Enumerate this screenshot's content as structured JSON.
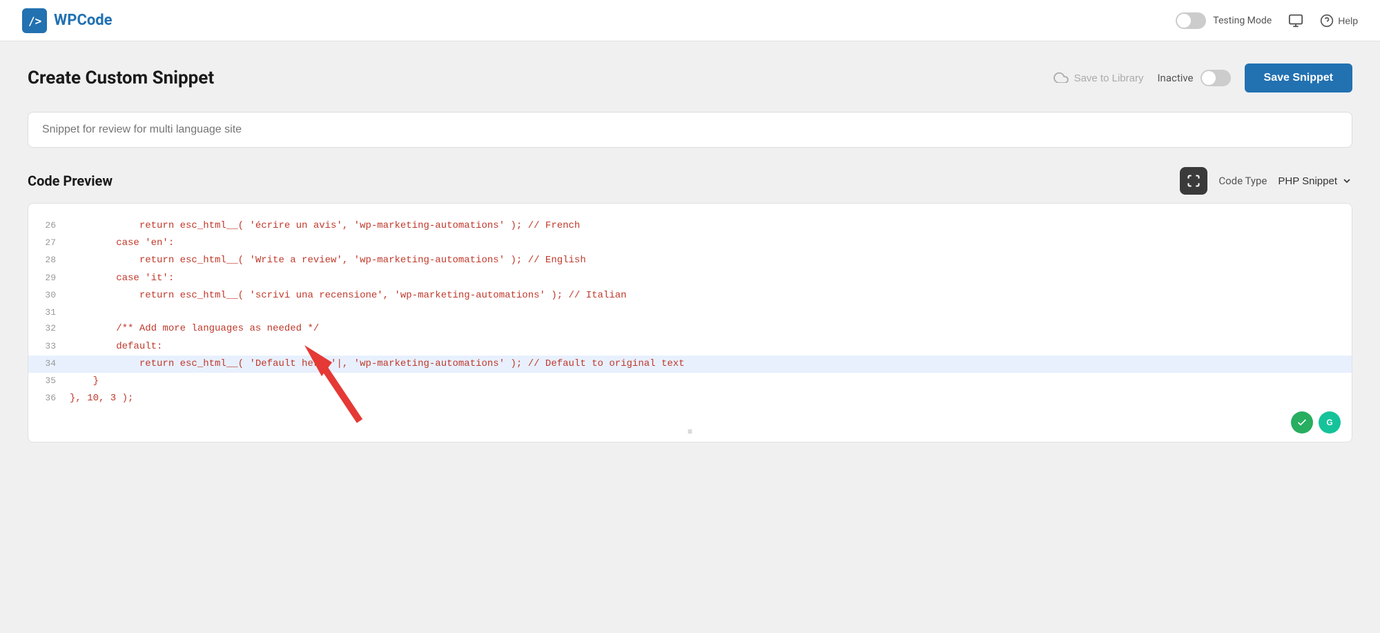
{
  "topbar": {
    "logo_icon": "/>",
    "logo_wp": "WP",
    "logo_code": "Code",
    "testing_mode_label": "Testing Mode",
    "help_label": "Help"
  },
  "page": {
    "title": "Create Custom Snippet",
    "save_to_library": "Save to Library",
    "inactive_label": "Inactive",
    "save_snippet_label": "Save Snippet"
  },
  "snippet": {
    "name_placeholder": "Snippet for review for multi language site"
  },
  "code_preview": {
    "title": "Code Preview",
    "code_type_label": "Code Type",
    "code_type_value": "PHP Snippet",
    "lines": [
      {
        "num": "26",
        "code": "            return esc_html__( 'écrire un avis', 'wp-marketing-automations' ); // French",
        "highlight": false
      },
      {
        "num": "27",
        "code": "        case 'en':",
        "highlight": false
      },
      {
        "num": "28",
        "code": "            return esc_html__( 'Write a review', 'wp-marketing-automations' ); // English",
        "highlight": false
      },
      {
        "num": "29",
        "code": "        case 'it':",
        "highlight": false
      },
      {
        "num": "30",
        "code": "            return esc_html__( 'scrivi una recensione', 'wp-marketing-automations' ); // Italian",
        "highlight": false
      },
      {
        "num": "31",
        "code": "",
        "highlight": false
      },
      {
        "num": "32",
        "code": "        /** Add more languages as needed */",
        "highlight": false
      },
      {
        "num": "33",
        "code": "        default:",
        "highlight": false
      },
      {
        "num": "34",
        "code": "            return esc_html__( 'Default here '|, 'wp-marketing-automations' ); // Default to original text",
        "highlight": true
      },
      {
        "num": "35",
        "code": "    }",
        "highlight": false
      },
      {
        "num": "36",
        "code": "}, 10, 3 );",
        "highlight": false
      }
    ]
  }
}
